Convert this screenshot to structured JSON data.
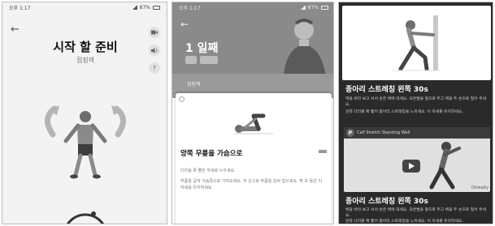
{
  "status": {
    "time": "오후 1:17",
    "right": "87%"
  },
  "screen1": {
    "title": "시작 할 준비",
    "subtitle": "점핑잭",
    "icons": [
      "back-arrow-icon",
      "video-icon",
      "volume-icon",
      "help-icon"
    ],
    "help_label": "?"
  },
  "screen2": {
    "day_title": "1 일째",
    "behind_label": "점핑잭",
    "exercise_title": "양쪽 무릎을 가슴으로",
    "description": [
      "다리를 쭉 뻗은 자세로 누우세요.",
      "무릎을 굽혀 가슴쪽으로 가져오세요. 두 손으로 무릎을 감싸 잡으세요. 몇 초 동안 이 자세를 유지하세요."
    ]
  },
  "screen3": {
    "card1_title": "종아리 스트레칭 왼쪽 30s",
    "card1_desc": "벽을 바라 보고 서서 손은 벽에 대세요. 오른발을 앞으로 두고 벽을 두 손으로 밀어 주세요.",
    "card1_desc2": "왼쪽 다리를 쭉 뻗어 종아리 스트레칭을 느끼세요. 이 자세를 유지하세요.",
    "video_channel_letter": "P",
    "video_title": "Calf Stretch Standing Wall",
    "video_brand": "Olirealty",
    "card2_title": "종아리 스트레칭 왼쪽 30s",
    "card2_desc": "벽을 바라 보고 서서 손은 벽에 대세요. 오른발을 앞으로 두고 벽을 두 손으로 밀어 주세요.",
    "card2_desc2": "왼쪽 다리를 쭉 뻗어 종아리 스트레칭을 느끼세요. 이 자세를 유지하세요."
  }
}
